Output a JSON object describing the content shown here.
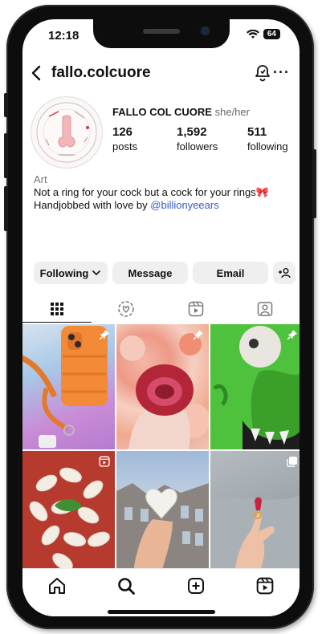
{
  "status": {
    "time": "12:18",
    "battery": "64"
  },
  "header": {
    "username": "fallo.colcuore"
  },
  "profile": {
    "avatar_label": "HANDJOB WITH LOVE · FALLO COL CUORE",
    "full_name": "FALLO COL CUORE",
    "pronouns": "she/her",
    "category": "Art",
    "bio_line1": "Not a ring for your cock but a cock for your rings🎀",
    "bio_line2_prefix": "Handjobbed with love by ",
    "bio_mention": "@billionyeears",
    "stats": [
      {
        "num": "126",
        "label": "posts"
      },
      {
        "num": "1,592",
        "label": "followers"
      },
      {
        "num": "511",
        "label": "following"
      }
    ]
  },
  "actions": {
    "following": "Following",
    "message": "Message",
    "email": "Email"
  },
  "tabs": [
    "grid-icon",
    "collab-heart-icon",
    "reels-icon",
    "tagged-icon"
  ],
  "grid": {
    "posts": [
      {
        "badge": "pin-icon",
        "desc": "orange phone case"
      },
      {
        "badge": "pin-icon",
        "desc": "hand holding red ring"
      },
      {
        "badge": "pin-icon",
        "desc": "green monster sculpture"
      },
      {
        "badge": "reels-icon",
        "desc": "white shells on red"
      },
      {
        "badge": "none",
        "desc": "hand holding ceramic heart"
      },
      {
        "badge": "carousel-icon",
        "desc": "hand with red ring on sand"
      }
    ]
  },
  "nav": [
    "home-icon",
    "search-icon",
    "create-icon",
    "reels-icon"
  ],
  "colors": {
    "mention": "#3a59c9",
    "button_bg": "#efefef"
  }
}
